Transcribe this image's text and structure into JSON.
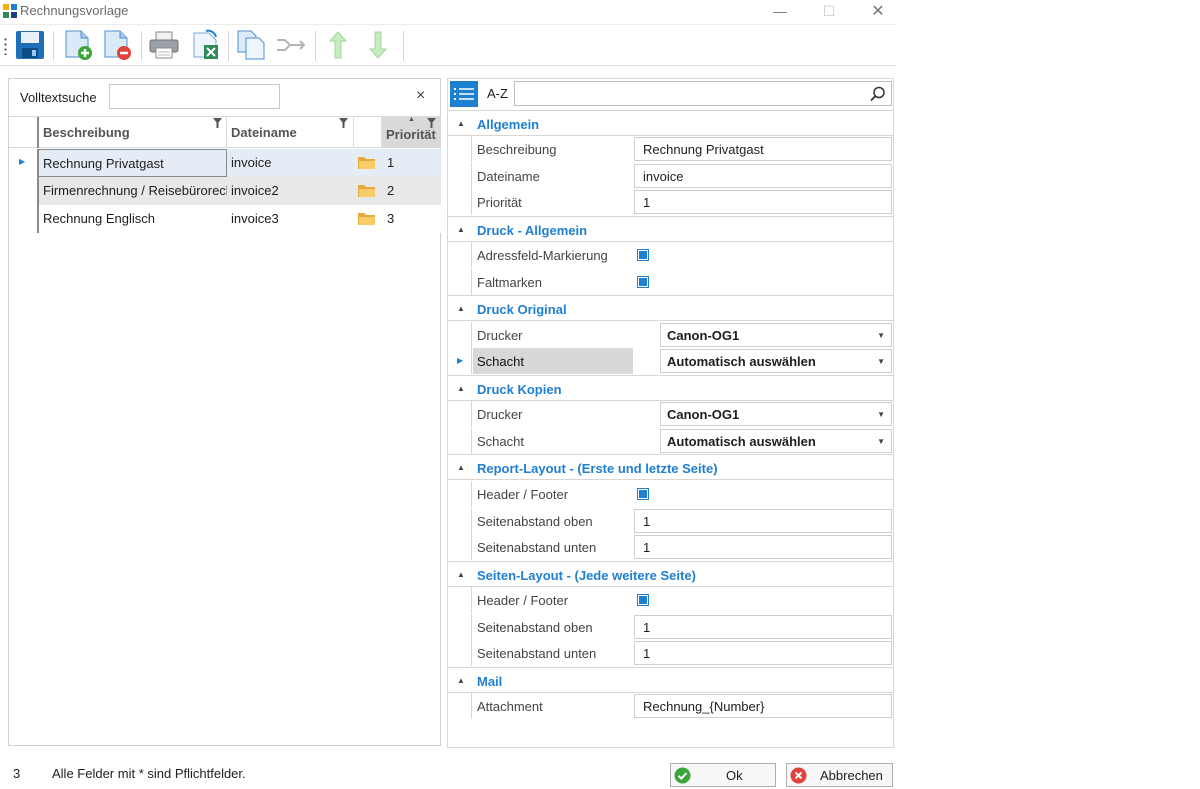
{
  "window": {
    "title": "Rechnungsvorlage",
    "minimize": "—",
    "maximize": "☐",
    "close": "✕"
  },
  "toolbar": {
    "buttons": [
      "save-icon",
      "new-document-icon",
      "delete-document-icon",
      "print-icon",
      "export-excel-icon",
      "copy-document-icon",
      "assign-icon",
      "move-up-icon",
      "move-down-icon"
    ]
  },
  "search": {
    "label": "Volltextsuche",
    "value": "",
    "clear": "×"
  },
  "grid": {
    "columns": [
      "Beschreibung",
      "Dateiname",
      "",
      "Priorität"
    ],
    "rows": [
      {
        "beschreibung": "Rechnung Privatgast",
        "dateiname": "invoice",
        "prioritaet": "1"
      },
      {
        "beschreibung": "Firmenrechnung / Reisebürorechnung",
        "dateiname": "invoice2",
        "prioritaet": "2"
      },
      {
        "beschreibung": "Rechnung Englisch",
        "dateiname": "invoice3",
        "prioritaet": "3"
      }
    ]
  },
  "property_grid": {
    "sort_label": "A-Z",
    "search_value": "",
    "categories": {
      "allgemein": {
        "label": "Allgemein",
        "beschreibung_label": "Beschreibung",
        "beschreibung_value": "Rechnung Privatgast",
        "dateiname_label": "Dateiname",
        "dateiname_value": "invoice",
        "prioritaet_label": "Priorität",
        "prioritaet_value": "1"
      },
      "druck_allgemein": {
        "label": "Druck - Allgemein",
        "adressfeld_label": "Adressfeld-Markierung",
        "adressfeld_checked": true,
        "faltmarken_label": "Faltmarken",
        "faltmarken_checked": true
      },
      "druck_original": {
        "label": "Druck Original",
        "drucker_label": "Drucker",
        "drucker_value": "Canon-OG1",
        "schacht_label": "Schacht",
        "schacht_value": "Automatisch auswählen"
      },
      "druck_kopien": {
        "label": "Druck Kopien",
        "drucker_label": "Drucker",
        "drucker_value": "Canon-OG1",
        "schacht_label": "Schacht",
        "schacht_value": "Automatisch auswählen"
      },
      "report_layout": {
        "label": "Report-Layout - (Erste und letzte Seite)",
        "header_label": "Header / Footer",
        "header_checked": true,
        "oben_label": "Seitenabstand oben",
        "oben_value": "1",
        "unten_label": "Seitenabstand unten",
        "unten_value": "1"
      },
      "seiten_layout": {
        "label": "Seiten-Layout - (Jede weitere Seite)",
        "header_label": "Header / Footer",
        "header_checked": true,
        "oben_label": "Seitenabstand oben",
        "oben_value": "1",
        "unten_label": "Seitenabstand unten",
        "unten_value": "1"
      },
      "mail": {
        "label": "Mail",
        "attachment_label": "Attachment",
        "attachment_value": "Rechnung_{Number}"
      }
    }
  },
  "status": {
    "count": "3",
    "text": "Alle Felder mit * sind Pflichtfelder."
  },
  "buttons": {
    "ok": "Ok",
    "cancel": "Abbrechen"
  },
  "colors": {
    "accent": "#1f7fd1",
    "selected_row": "#e4edf5",
    "alt_row": "#e8e8e8"
  }
}
